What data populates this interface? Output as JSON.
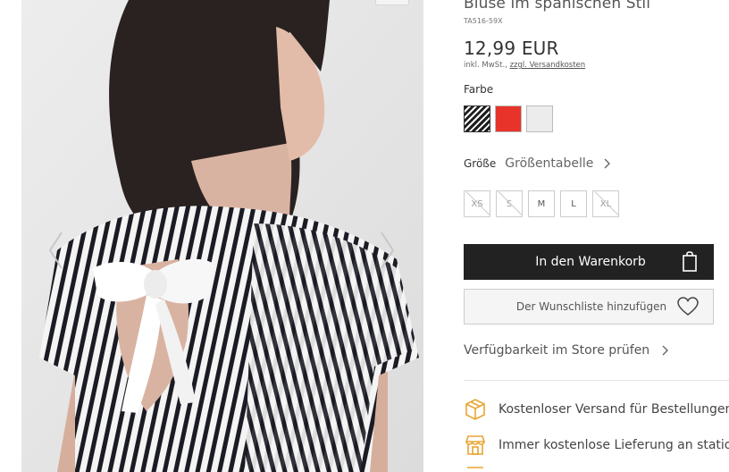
{
  "product": {
    "title": "Bluse im spanischen Stil",
    "sku": "TA516-59X",
    "price": "12,99 EUR",
    "tax_note": "inkl. MwSt.,",
    "shipping_link": "zzgl. Versandkosten"
  },
  "colors": {
    "label": "Farbe",
    "swatches": [
      {
        "name": "stripe-black-white",
        "color": "#1e1e1e"
      },
      {
        "name": "red",
        "color": "#e8332a"
      },
      {
        "name": "light-grey",
        "color": "#ececec"
      }
    ]
  },
  "sizes": {
    "label": "Größe",
    "size_table_link": "Größentabelle",
    "options": [
      {
        "label": "XS",
        "available": false
      },
      {
        "label": "S",
        "available": false
      },
      {
        "label": "M",
        "available": true
      },
      {
        "label": "L",
        "available": true
      },
      {
        "label": "XL",
        "available": false
      }
    ]
  },
  "actions": {
    "add_to_cart": "In den Warenkorb",
    "add_to_wishlist": "Der Wunschliste hinzufügen",
    "check_store": "Verfügbarkeit im Store prüfen"
  },
  "benefits": [
    {
      "icon": "package-icon",
      "text": "Kostenloser Versand für Bestellungen"
    },
    {
      "icon": "store-icon",
      "text": "Immer kostenlose Lieferung an stationäre"
    }
  ],
  "theme": {
    "accent": "#e8a534",
    "button_dark": "#222222"
  }
}
